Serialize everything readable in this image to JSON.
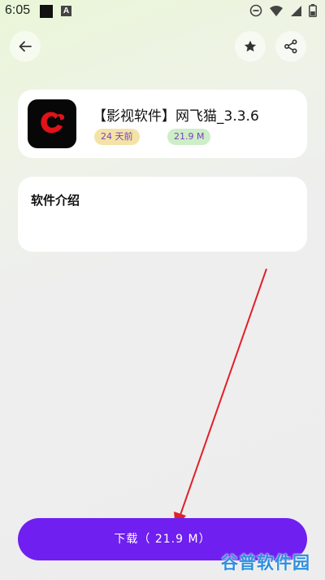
{
  "status_bar": {
    "time": "6:05",
    "notification_icon": "A",
    "icons": [
      "do-not-disturb-icon",
      "wifi-icon",
      "signal-icon",
      "battery-icon"
    ]
  },
  "toolbar": {
    "back_icon": "arrow-left-icon",
    "favorite_icon": "star-icon",
    "share_icon": "share-icon"
  },
  "app": {
    "title": "【影视软件】网飞猫_3.3.6",
    "updated": "24 天前",
    "size": "21.9 M",
    "icon_colors": {
      "background": "#070707",
      "accent": "#e11218"
    }
  },
  "intro": {
    "title": "软件介绍"
  },
  "download": {
    "label": "下载（ 21.9 M）",
    "color": "#6f1ff0"
  },
  "watermark": {
    "text": "谷普软件园"
  },
  "annotation": {
    "arrow_color": "#e0202a"
  }
}
